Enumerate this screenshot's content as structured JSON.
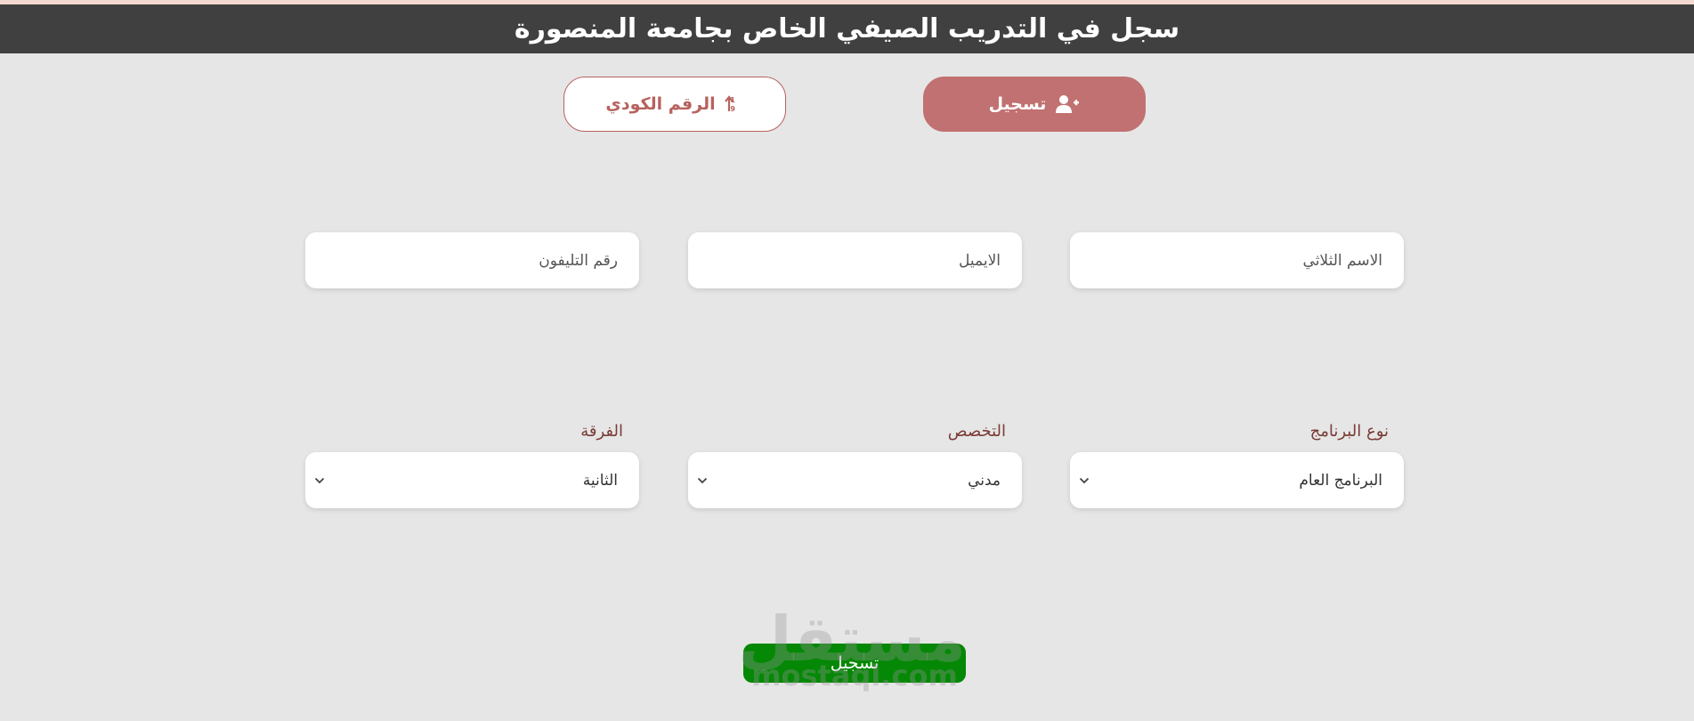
{
  "header": {
    "title": "سجل في التدريب الصيفي الخاص بجامعة المنصورة"
  },
  "tabs": {
    "register": {
      "label": "تسجيل",
      "icon": "user-plus-icon"
    },
    "code": {
      "label": "الرقم الكودي",
      "icon": "sort-numeric-icon"
    }
  },
  "form": {
    "full_name": {
      "placeholder": "الاسم الثلاثي"
    },
    "email": {
      "placeholder": "الايميل"
    },
    "phone": {
      "placeholder": "رقم التليفون"
    },
    "program_type": {
      "label": "نوع البرنامج",
      "value": "البرنامج العام"
    },
    "specialization": {
      "label": "التخصص",
      "value": "مدني"
    },
    "year": {
      "label": "الفرقة",
      "value": "الثانية"
    },
    "submit_label": "تسجيل"
  },
  "watermark": {
    "arabic": "مستقل",
    "latin": "mostaql.com"
  },
  "colors": {
    "header_bg": "#404040",
    "register_tab": "#c17171",
    "code_tab_text": "#b7625e",
    "submit_green": "#058805",
    "label_color": "#7a3b36"
  }
}
